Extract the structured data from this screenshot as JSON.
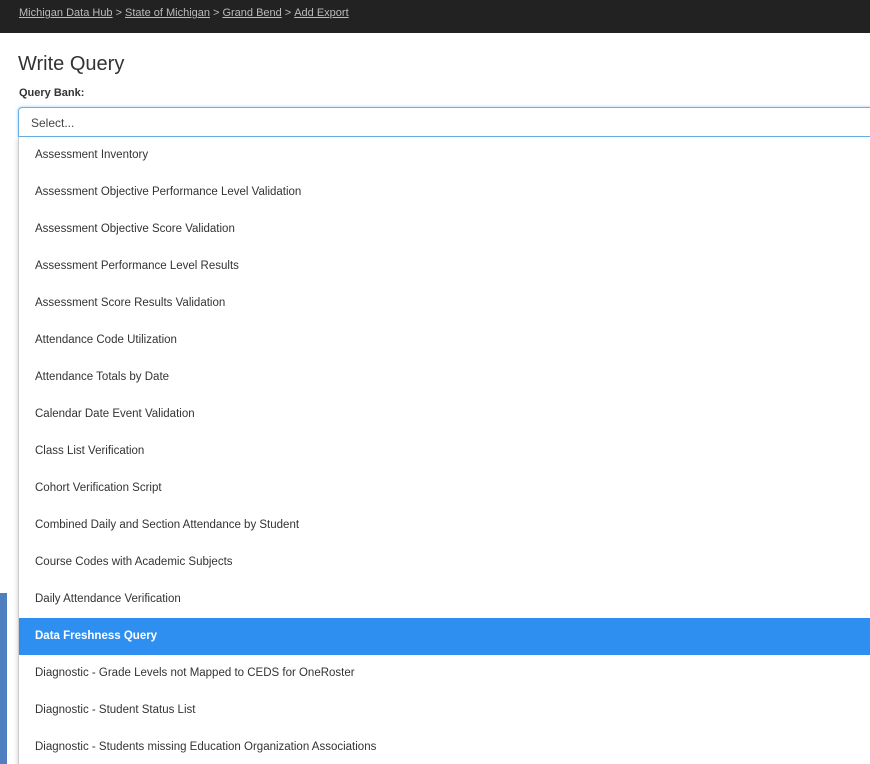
{
  "breadcrumb": {
    "items": [
      "Michigan Data Hub",
      "State of Michigan",
      "Grand Bend",
      "Add Export"
    ],
    "separator": ">"
  },
  "page": {
    "title": "Write Query"
  },
  "query_bank": {
    "label": "Query Bank:",
    "placeholder": "Select...",
    "highlighted_option": "Data Freshness Query",
    "options": [
      "Assessment Inventory",
      "Assessment Objective Performance Level Validation",
      "Assessment Objective Score Validation",
      "Assessment Performance Level Results",
      "Assessment Score Results Validation",
      "Attendance Code Utilization",
      "Attendance Totals by Date",
      "Calendar Date Event Validation",
      "Class List Verification",
      "Cohort Verification Script",
      "Combined Daily and Section Attendance by Student",
      "Course Codes with Academic Subjects",
      "Daily Attendance Verification",
      "Data Freshness Query",
      "Diagnostic - Grade Levels not Mapped to CEDS for OneRoster",
      "Diagnostic - Student Status List",
      "Diagnostic - Students missing Education Organization Associations"
    ]
  },
  "colors": {
    "topbar": "#222222",
    "highlight": "#2f8ff0",
    "focus_border": "#66afe9"
  }
}
